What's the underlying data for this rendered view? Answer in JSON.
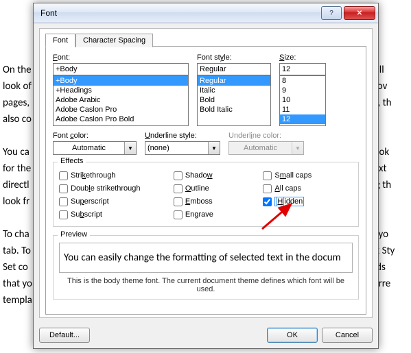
{
  "bg_lines": "On the\nlook of\npages,\nalso co\n\nYou ca\nfor the\ndirectl\nlook fr\n\nTo cha\ntab. To\nSet co\nthat yo\ntempla\n",
  "bg_right": "the overall\nrs, lists, cov\ndiagrams, th\n\n\nosing a look\nformat text\ne of using th\n\n\ne Page Layo\nent Quick Sty\ncommands\nn your curre\n",
  "dialog": {
    "title": "Font",
    "tabs": [
      "Font",
      "Character Spacing"
    ],
    "font": {
      "label": "Font:",
      "value": "+Body",
      "options": [
        "+Body",
        "+Headings",
        "Adobe Arabic",
        "Adobe Caslon Pro",
        "Adobe Caslon Pro Bold"
      ]
    },
    "style": {
      "label": "Font style:",
      "value": "Regular",
      "options": [
        "Regular",
        "Italic",
        "Bold",
        "Bold Italic"
      ]
    },
    "size": {
      "label": "Size:",
      "value": "12",
      "options": [
        "8",
        "9",
        "10",
        "11",
        "12"
      ]
    },
    "fontcolor": {
      "label": "Font color:",
      "value": "Automatic"
    },
    "ustyle": {
      "label": "Underline style:",
      "value": "(none)"
    },
    "ucolor": {
      "label": "Underline color:",
      "value": "Automatic"
    },
    "effects": {
      "label": "Effects",
      "items": {
        "strike": "Strikethrough",
        "dstrike": "Double strikethrough",
        "sup": "Superscript",
        "sub": "Subscript",
        "shadow": "Shadow",
        "outline": "Outline",
        "emboss": "Emboss",
        "engrave": "Engrave",
        "small": "Small caps",
        "all": "All caps",
        "hidden": "Hidden"
      }
    },
    "preview": {
      "label": "Preview",
      "text": "You can easily change the formatting of selected text in the docum",
      "note": "This is the body theme font. The current document theme defines which font will be used."
    },
    "buttons": {
      "default": "Default...",
      "ok": "OK",
      "cancel": "Cancel"
    }
  }
}
